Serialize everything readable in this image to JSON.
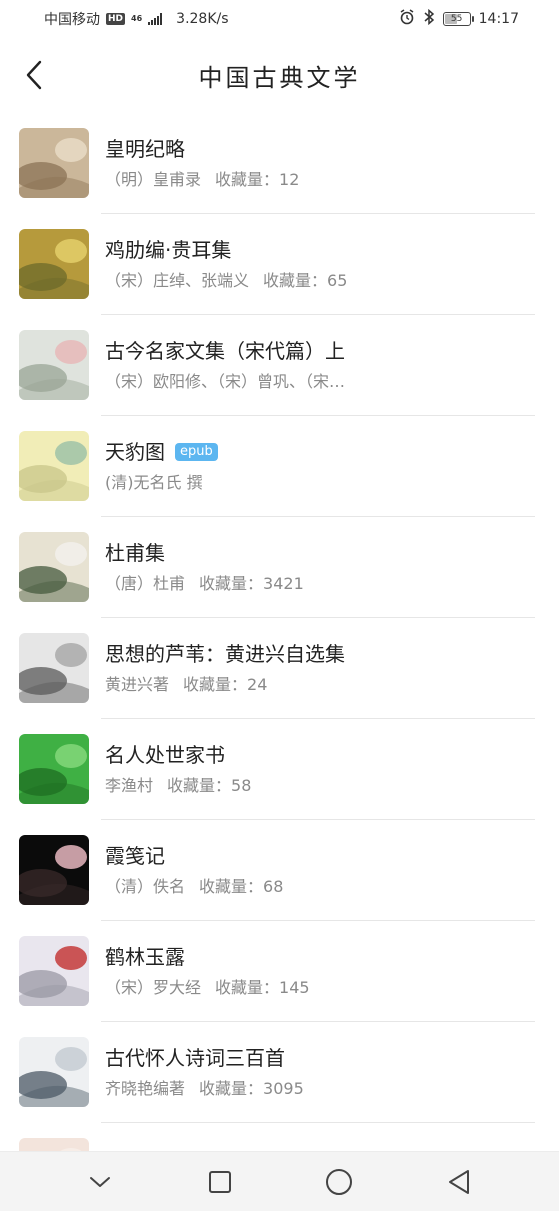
{
  "status_bar": {
    "carrier": "中国移动",
    "hd": "HD",
    "network_top": "46",
    "network_bottom": "ıl",
    "speed": "3.28K/s",
    "battery": "55",
    "battery_level": 0.55,
    "time": "14:17"
  },
  "header": {
    "title": "中国古典文学",
    "back_icon": "chevron-left-icon"
  },
  "books": [
    {
      "title": "皇明纪略",
      "author": "（明）皇甫录",
      "favorites_label": "收藏量：",
      "favorites": "12",
      "badge": "",
      "cover_colors": [
        "#cbb79a",
        "#8b7355",
        "#e9dcc6"
      ]
    },
    {
      "title": "鸡肋编·贵耳集",
      "author": "（宋）庄绰、张端义",
      "favorites_label": "收藏量：",
      "favorites": "65",
      "badge": "",
      "cover_colors": [
        "#b69a3c",
        "#6c6a2a",
        "#e4cf6a"
      ]
    },
    {
      "title": "古今名家文集（宋代篇）上",
      "author": "（宋）欧阳修、（宋）曾巩、（宋…",
      "favorites_label": "",
      "favorites": "",
      "badge": "",
      "cover_colors": [
        "#dfe3dd",
        "#9aa595",
        "#e8b9b9"
      ]
    },
    {
      "title": "天豹图",
      "author": "(清)无名氏 撰",
      "favorites_label": "",
      "favorites": "",
      "badge": "epub",
      "cover_colors": [
        "#f1edb7",
        "#c8c58a",
        "#9fc2a8"
      ]
    },
    {
      "title": "杜甫集",
      "author": "（唐）杜甫",
      "favorites_label": "收藏量：",
      "favorites": "3421",
      "badge": "",
      "cover_colors": [
        "#e7e2d2",
        "#465a3e",
        "#f2f0ec"
      ]
    },
    {
      "title": "思想的芦苇：黄进兴自选集",
      "author": "黄进兴著",
      "favorites_label": "收藏量：",
      "favorites": "24",
      "badge": "",
      "cover_colors": [
        "#e6e6e6",
        "#5a5a5a",
        "#a9a9a9"
      ]
    },
    {
      "title": "名人处世家书",
      "author": "李渔村",
      "favorites_label": "收藏量：",
      "favorites": "58",
      "badge": "",
      "cover_colors": [
        "#3fb044",
        "#1f6e22",
        "#84d87a"
      ]
    },
    {
      "title": "霞笺记",
      "author": "（清）佚名",
      "favorites_label": "收藏量：",
      "favorites": "68",
      "badge": "",
      "cover_colors": [
        "#0b0b0b",
        "#3a2a2a",
        "#e7b7c0"
      ]
    },
    {
      "title": "鹤林玉露",
      "author": "（宋）罗大经",
      "favorites_label": "收藏量：",
      "favorites": "145",
      "badge": "",
      "cover_colors": [
        "#e9e6ee",
        "#9a98a4",
        "#c43a3a"
      ]
    },
    {
      "title": "古代怀人诗词三百首",
      "author": "齐晓艳编著",
      "favorites_label": "收藏量：",
      "favorites": "3095",
      "badge": "",
      "cover_colors": [
        "#eef0f2",
        "#4c5a66",
        "#c6ccd4"
      ]
    },
    {
      "title": "",
      "author": "",
      "favorites_label": "",
      "favorites": "",
      "badge": "",
      "cover_colors": [
        "#f3e4dc",
        "#c9a38d",
        "#f7efe9"
      ]
    }
  ],
  "nav": {
    "back": "chevron-down-icon",
    "recents": "square-icon",
    "home": "circle-icon",
    "return": "triangle-left-icon"
  }
}
